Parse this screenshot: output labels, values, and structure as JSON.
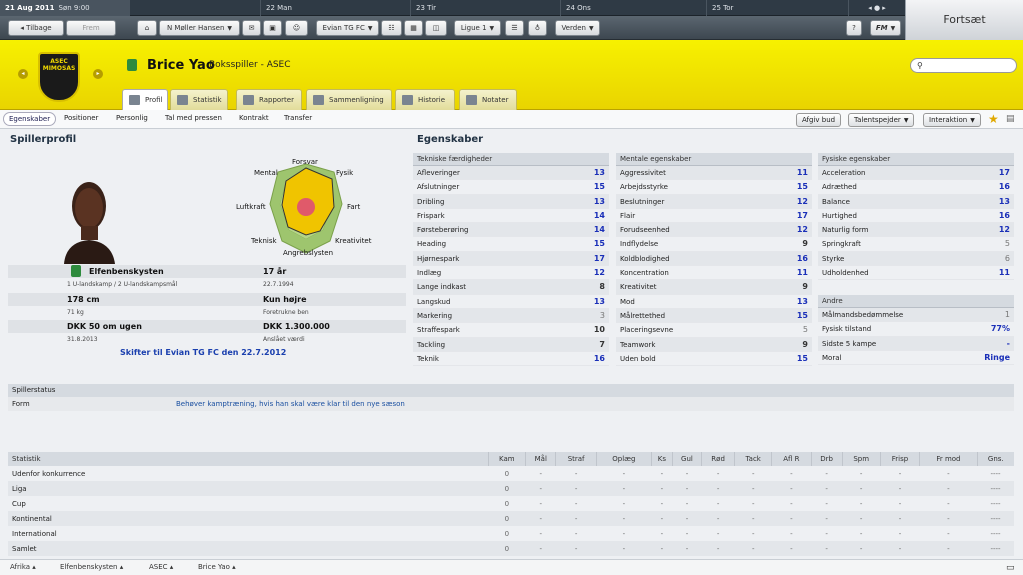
{
  "datebar": {
    "current": "21 Aug 2011",
    "current_detail": "Søn 9:00",
    "days": [
      "22 Man",
      "23 Tir",
      "24 Ons",
      "25 Tor"
    ]
  },
  "continue_label": "Fortsæt",
  "nav": {
    "back": "Tilbage",
    "forward": "Frem",
    "manager": "N Møller Hansen",
    "club": "Evian TG FC",
    "league": "Ligue 1",
    "world": "Verden",
    "help": "?",
    "fm": "FM"
  },
  "player": {
    "name": "Brice Yao",
    "role": "Boksspiller - ASEC",
    "club_crest_text": "ASEC MIMOSAS"
  },
  "search": {
    "placeholder": ""
  },
  "tabs": [
    "Profil",
    "Statistik",
    "Rapporter",
    "Sammenligning",
    "Historie",
    "Notater"
  ],
  "subnav": [
    "Egenskaber",
    "Positioner",
    "Personlig",
    "Tal med pressen",
    "Kontrakt",
    "Transfer"
  ],
  "actions": {
    "reject": "Afgiv bud",
    "scout": "Talentspejder",
    "interaction": "Interaktion"
  },
  "profile": {
    "heading": "Spillerprofil",
    "radar_labels": [
      "Forsvar",
      "Fysik",
      "Fart",
      "Kreativitet",
      "Angrebslysten",
      "Teknisk",
      "Luftkraft",
      "Mental"
    ],
    "nationality": "Elfenbenskysten",
    "caps": "1 U-landskamp / 2 U-landskampsmål",
    "age": "17 år",
    "dob": "22.7.1994",
    "height": "178 cm",
    "weight": "71 kg",
    "foot": "Kun højre",
    "foot_detail": "Foretrukne ben",
    "wage": "DKK 50 om ugen",
    "contract_end": "31.8.2013",
    "value": "DKK 1.300.000",
    "value_detail": "Anslået værdi",
    "transfer_note": "Skifter til Evian TG FC den 22.7.2012"
  },
  "attributes": {
    "heading": "Egenskaber",
    "technical": {
      "title": "Tekniske færdigheder",
      "rows": [
        [
          "Afleveringer",
          "13"
        ],
        [
          "Afslutninger",
          "15"
        ],
        [
          "Dribling",
          "13"
        ],
        [
          "Frispark",
          "14"
        ],
        [
          "Førsteberøring",
          "14"
        ],
        [
          "Heading",
          "15"
        ],
        [
          "Hjørnespark",
          "17"
        ],
        [
          "Indlæg",
          "12"
        ],
        [
          "Lange indkast",
          "8"
        ],
        [
          "Langskud",
          "13"
        ],
        [
          "Markering",
          "3"
        ],
        [
          "Straffespark",
          "10"
        ],
        [
          "Tackling",
          "7"
        ],
        [
          "Teknik",
          "16"
        ]
      ]
    },
    "mental": {
      "title": "Mentale egenskaber",
      "rows": [
        [
          "Aggressivitet",
          "11"
        ],
        [
          "Arbejdsstyrke",
          "15"
        ],
        [
          "Beslutninger",
          "12"
        ],
        [
          "Flair",
          "17"
        ],
        [
          "Forudseenhed",
          "12"
        ],
        [
          "Indflydelse",
          "9"
        ],
        [
          "Koldblodighed",
          "16"
        ],
        [
          "Koncentration",
          "11"
        ],
        [
          "Kreativitet",
          "9"
        ],
        [
          "Mod",
          "13"
        ],
        [
          "Målrettethed",
          "15"
        ],
        [
          "Placeringsevne",
          "5"
        ],
        [
          "Teamwork",
          "9"
        ],
        [
          "Uden bold",
          "15"
        ]
      ]
    },
    "physical": {
      "title": "Fysiske egenskaber",
      "rows": [
        [
          "Acceleration",
          "17"
        ],
        [
          "Adræthed",
          "16"
        ],
        [
          "Balance",
          "13"
        ],
        [
          "Hurtighed",
          "16"
        ],
        [
          "Naturlig form",
          "12"
        ],
        [
          "Springkraft",
          "5"
        ],
        [
          "Styrke",
          "6"
        ],
        [
          "Udholdenhed",
          "11"
        ]
      ]
    },
    "other": {
      "title": "Andre",
      "rows": [
        [
          "Målmandsbedømmelse",
          "1"
        ],
        [
          "Fysisk tilstand",
          "77%"
        ],
        [
          "Sidste 5 kampe",
          "-"
        ],
        [
          "Moral",
          "Ringe"
        ]
      ]
    }
  },
  "status": {
    "title": "Spillerstatus",
    "label": "Form",
    "value": "Behøver kamptræning, hvis han skal være klar til den nye sæson"
  },
  "stats": {
    "columns": [
      "Statistik",
      "Kam",
      "Mål",
      "Straf",
      "Oplæg",
      "Ks",
      "Gul",
      "Rød",
      "Tack",
      "Afl R",
      "Drb",
      "Spm",
      "Frisp",
      "Fr mod",
      "Gns."
    ],
    "rows": [
      [
        "Udenfor konkurrence",
        "0",
        "-",
        "-",
        "-",
        "-",
        "-",
        "-",
        "-",
        "-",
        "-",
        "-",
        "-",
        "-",
        "----"
      ],
      [
        "Liga",
        "0",
        "-",
        "-",
        "-",
        "-",
        "-",
        "-",
        "-",
        "-",
        "-",
        "-",
        "-",
        "-",
        "----"
      ],
      [
        "Cup",
        "0",
        "-",
        "-",
        "-",
        "-",
        "-",
        "-",
        "-",
        "-",
        "-",
        "-",
        "-",
        "-",
        "----"
      ],
      [
        "Kontinental",
        "0",
        "-",
        "-",
        "-",
        "-",
        "-",
        "-",
        "-",
        "-",
        "-",
        "-",
        "-",
        "-",
        "----"
      ],
      [
        "International",
        "0",
        "-",
        "-",
        "-",
        "-",
        "-",
        "-",
        "-",
        "-",
        "-",
        "-",
        "-",
        "-",
        "----"
      ],
      [
        "Samlet",
        "0",
        "-",
        "-",
        "-",
        "-",
        "-",
        "-",
        "-",
        "-",
        "-",
        "-",
        "-",
        "-",
        "----"
      ]
    ]
  },
  "breadcrumbs": [
    "Afrika",
    "Elfenbenskysten",
    "ASEC",
    "Brice Yao"
  ],
  "colors": {
    "accent": "#1a2fb8",
    "header": "#f3e800",
    "nav": "#3d4750"
  }
}
